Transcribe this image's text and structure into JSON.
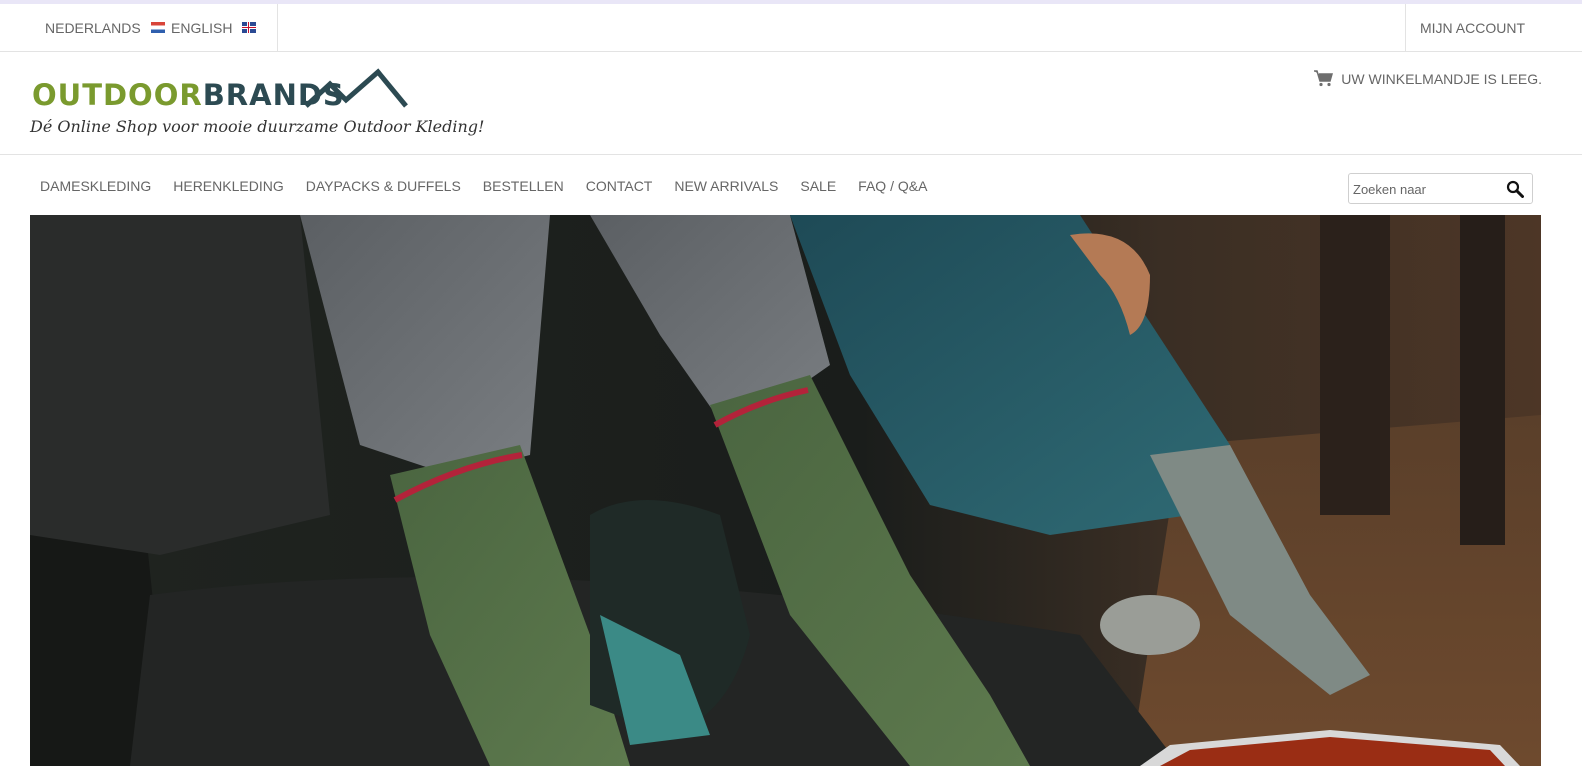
{
  "topbar": {
    "languages": [
      {
        "label": "NEDERLANDS",
        "flag": "flag-nl-icon"
      },
      {
        "label": "ENGLISH",
        "flag": "flag-uk-icon"
      }
    ],
    "account_label": "MIJN ACCOUNT"
  },
  "header": {
    "logo_part1": "OUTDOOR",
    "logo_part2": "BRANDS",
    "tagline": "Dé Online Shop voor mooie duurzame Outdoor Kleding!",
    "cart_label": "UW WINKELMANDJE IS LEEG.",
    "cart_icon": "shopping-cart-icon"
  },
  "nav": {
    "items": [
      "DAMESKLEDING",
      "HERENKLEDING",
      "DAYPACKS & DUFFELS",
      "BESTELLEN",
      "CONTACT",
      "NEW ARRIVALS",
      "SALE",
      "FAQ / Q&A"
    ]
  },
  "search": {
    "placeholder": "Zoeken naar",
    "icon": "magnifier-icon"
  },
  "hero": {
    "image": "hikers-wool-socks-photo"
  },
  "colors": {
    "logo_green": "#7a9a2e",
    "logo_dark": "#2c4a52",
    "nav_text": "#666666",
    "border": "#e3e3e3",
    "sock_green": "#4f6d43",
    "sock_stripe": "#b3233a"
  }
}
